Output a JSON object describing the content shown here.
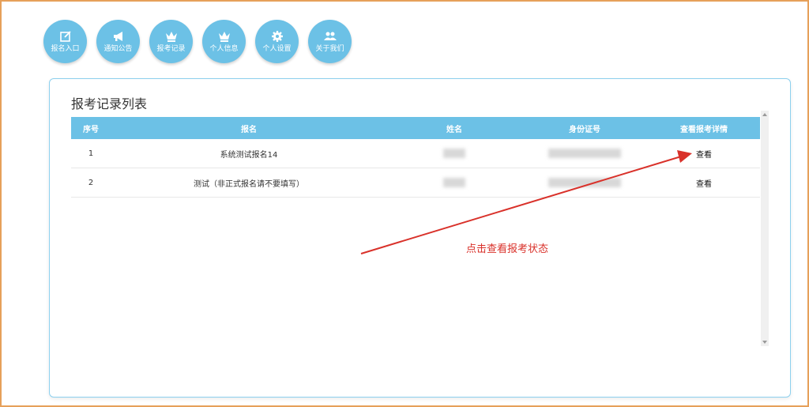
{
  "nav": {
    "items": [
      {
        "label": "报名入口",
        "icon": "edit-icon"
      },
      {
        "label": "通知公告",
        "icon": "megaphone-icon"
      },
      {
        "label": "报考记录",
        "icon": "crown-icon"
      },
      {
        "label": "个人信息",
        "icon": "crown-icon"
      },
      {
        "label": "个人设置",
        "icon": "gear-icon"
      },
      {
        "label": "关于我们",
        "icon": "users-icon"
      }
    ]
  },
  "panel": {
    "title": "报考记录列表"
  },
  "table": {
    "headers": [
      "序号",
      "报名",
      "姓名",
      "身份证号",
      "查看报考详情"
    ],
    "rows": [
      {
        "index": "1",
        "name": "系统测试报名14",
        "action": "查看"
      },
      {
        "index": "2",
        "name": "测试（非正式报名请不要填写）",
        "action": "查看"
      }
    ]
  },
  "annotation": {
    "text": "点击查看报考状态",
    "color": "#d9312a"
  },
  "colors": {
    "accent": "#6cc1e6",
    "border": "#e6a05a"
  }
}
